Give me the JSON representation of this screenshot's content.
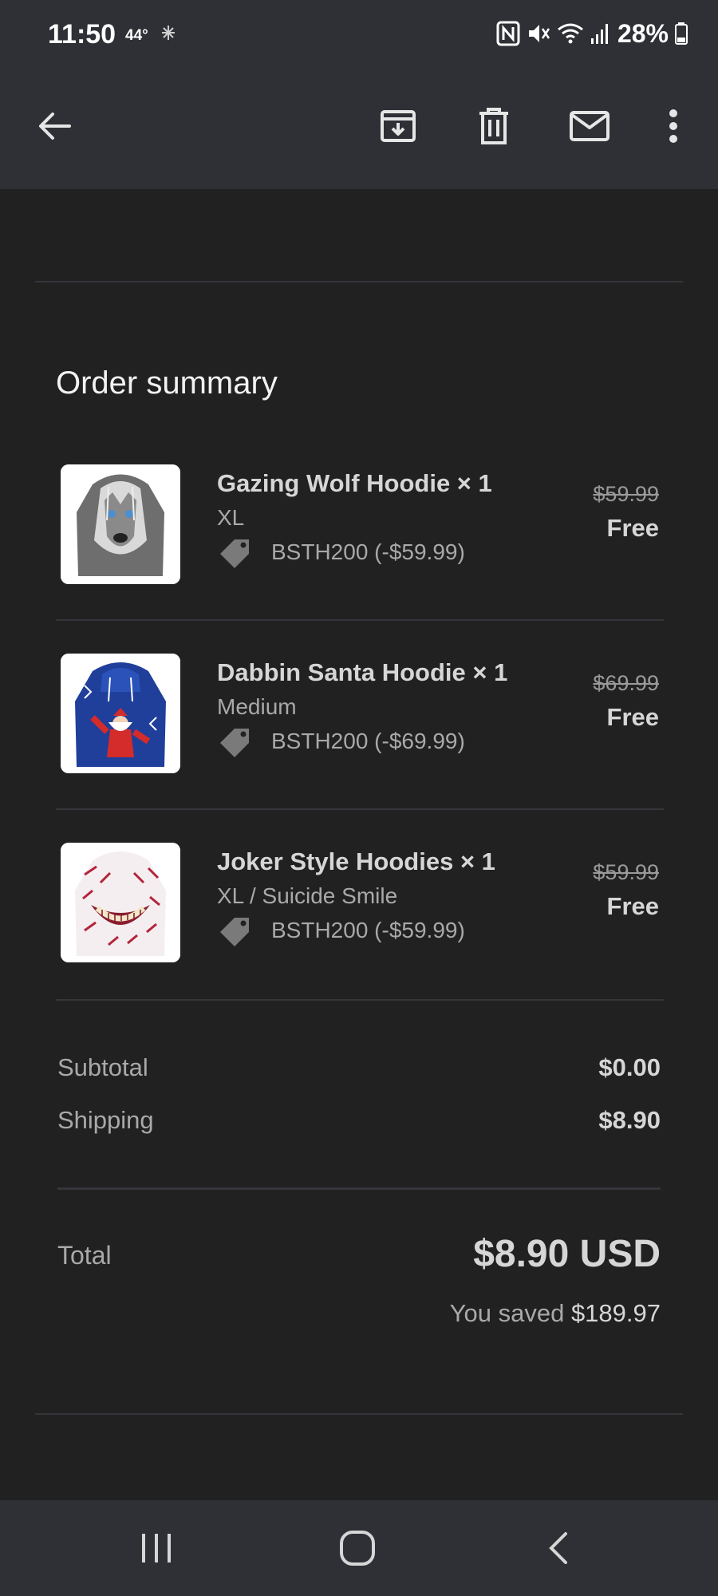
{
  "status_bar": {
    "time": "11:50",
    "temperature": "44°",
    "battery": "28%",
    "icons": [
      "nfc-icon",
      "mute-icon",
      "wifi-icon",
      "signal-icon",
      "battery-icon"
    ]
  },
  "toolbar": {
    "actions": [
      "back-icon",
      "archive-icon",
      "delete-icon",
      "mark-unread-icon",
      "more-icon"
    ]
  },
  "order": {
    "title": "Order summary",
    "items": [
      {
        "name": "Gazing Wolf Hoodie × 1",
        "variant": "XL",
        "discount": "BSTH200 (-$59.99)",
        "original_price": "$59.99",
        "price": "Free"
      },
      {
        "name": "Dabbin Santa Hoodie × 1",
        "variant": "Medium",
        "discount": "BSTH200 (-$69.99)",
        "original_price": "$69.99",
        "price": "Free"
      },
      {
        "name": "Joker Style Hoodies × 1",
        "variant": "XL / Suicide Smile",
        "discount": "BSTH200 (-$59.99)",
        "original_price": "$59.99",
        "price": "Free"
      }
    ],
    "subtotal_label": "Subtotal",
    "subtotal": "$0.00",
    "shipping_label": "Shipping",
    "shipping": "$8.90",
    "total_label": "Total",
    "total": "$8.90 USD",
    "saved_label": "You saved",
    "saved_amount": "$189.97"
  },
  "colors": {
    "background": "#212121",
    "bar": "#2e3035",
    "text_primary": "#d6d6d6",
    "text_secondary": "#a9a9a9"
  }
}
